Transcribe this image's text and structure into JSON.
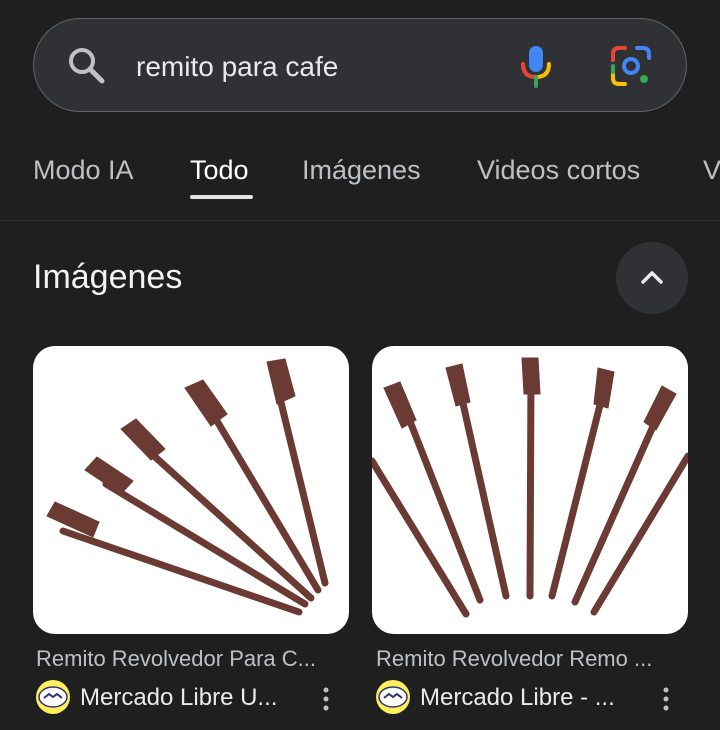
{
  "search": {
    "query": "remito para cafe",
    "icons": [
      "search-icon",
      "mic-icon",
      "google-lens-icon"
    ]
  },
  "tabs": [
    {
      "label": "Modo IA",
      "active": false
    },
    {
      "label": "Todo",
      "active": true
    },
    {
      "label": "Imágenes",
      "active": false
    },
    {
      "label": "Videos cortos",
      "active": false
    },
    {
      "label": "V",
      "active": false
    }
  ],
  "images_section": {
    "title": "Imágenes",
    "collapse_icon": "chevron-up-icon",
    "results": [
      {
        "caption": "Remito Revolvedor Para C...",
        "source": "Mercado Libre U...",
        "favicon": "mercado-libre-icon"
      },
      {
        "caption": "Remito Revolvedor Remo ...",
        "source": "Mercado Libre - ...",
        "favicon": "mercado-libre-icon"
      }
    ]
  },
  "colors": {
    "background": "#1f1f1f",
    "search_bar": "#303134",
    "stirrer_brown": "#6b3a32",
    "mercado_libre_yellow": "#fff159"
  }
}
